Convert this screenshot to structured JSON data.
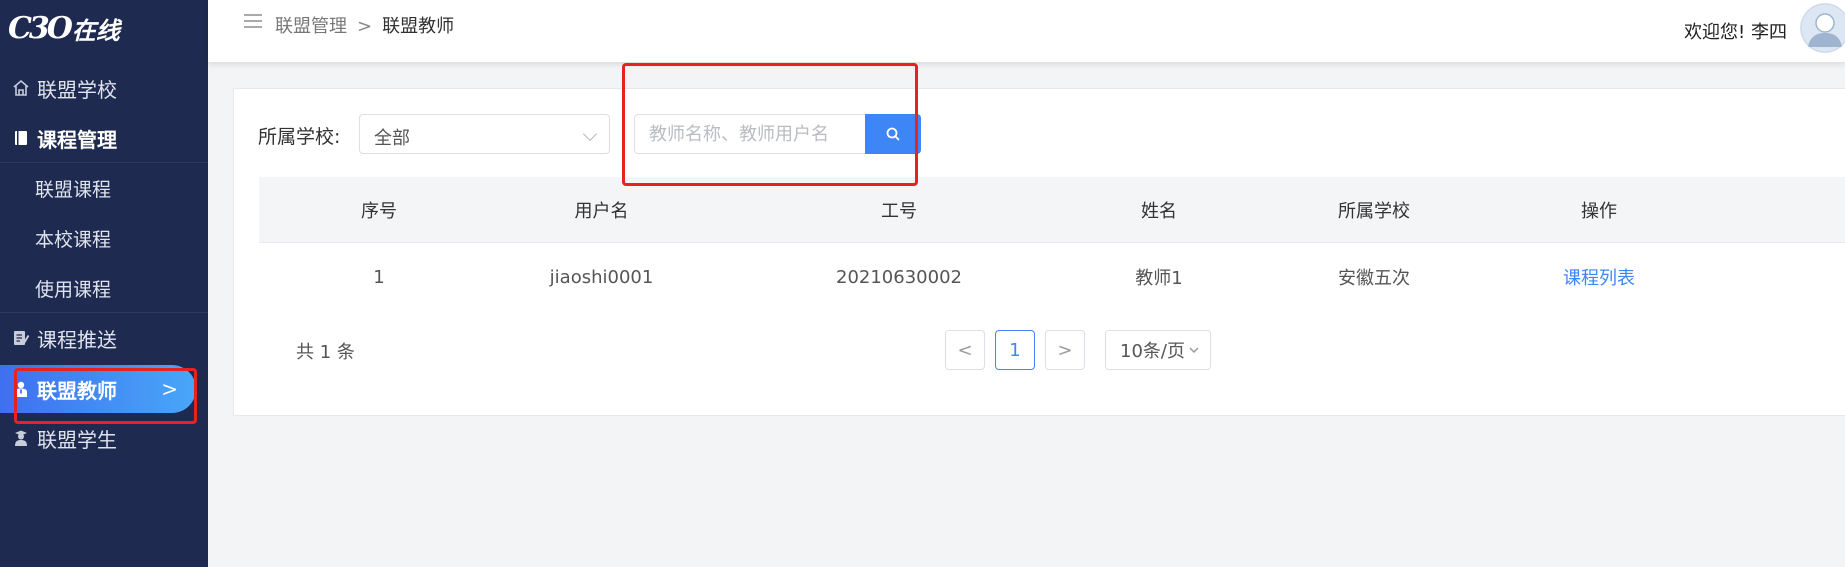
{
  "logo": {
    "mark": "C3O",
    "text": "在线"
  },
  "sidebar": {
    "items": [
      {
        "label": "联盟学校",
        "icon": "school-icon"
      },
      {
        "label": "课程管理",
        "icon": "book-icon"
      },
      {
        "label": "联盟课程"
      },
      {
        "label": "本校课程"
      },
      {
        "label": "使用课程"
      },
      {
        "label": "课程推送",
        "icon": "edit-doc-icon"
      },
      {
        "label": "联盟教师",
        "icon": "teacher-icon",
        "active": true,
        "chevron": ">"
      },
      {
        "label": "联盟学生",
        "icon": "student-icon"
      }
    ]
  },
  "header": {
    "breadcrumb": {
      "parent": "联盟管理",
      "separator": ">",
      "current": "联盟教师"
    },
    "welcome": "欢迎您!  李四"
  },
  "filters": {
    "school_label": "所属学校:",
    "school_value": "全部",
    "search_placeholder": "教师名称、教师用户名"
  },
  "table": {
    "columns": [
      "序号",
      "用户名",
      "工号",
      "姓名",
      "所属学校",
      "操作"
    ],
    "rows": [
      {
        "index": "1",
        "username": "jiaoshi0001",
        "job_no": "20210630002",
        "name": "教师1",
        "school": "安徽五次",
        "action": "课程列表"
      }
    ]
  },
  "pagination": {
    "total": "共 1 条",
    "prev": "<",
    "current_page": "1",
    "next": ">",
    "page_size": "10条/页"
  },
  "colors": {
    "sidebar_bg": "#1e2a4f",
    "accent": "#3e86f6",
    "annotation_red": "#e8231f"
  }
}
